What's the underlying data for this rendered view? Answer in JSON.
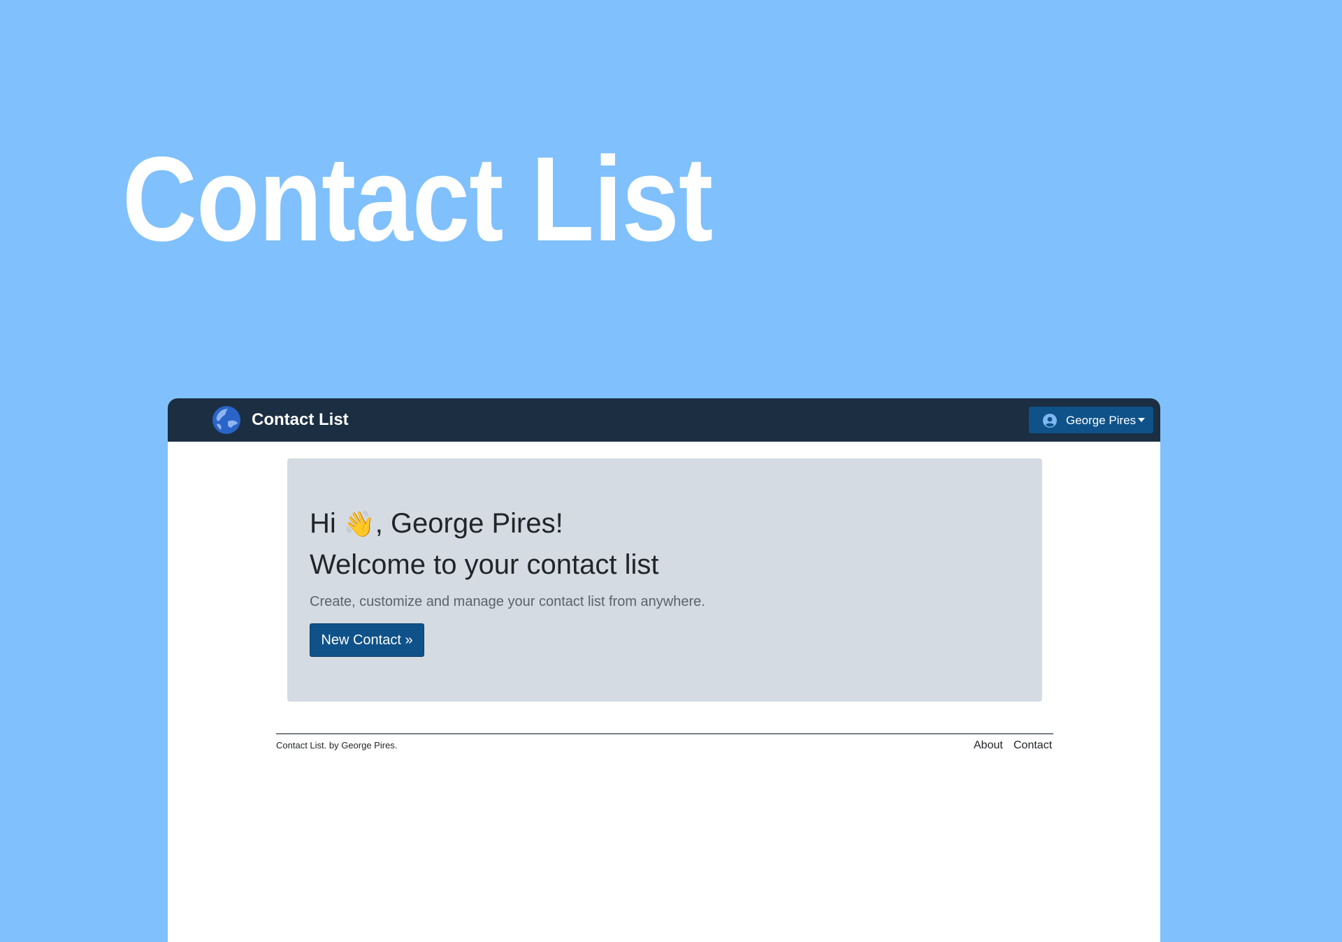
{
  "hero": {
    "title": "Contact List"
  },
  "navbar": {
    "brand_name": "Contact List",
    "brand_logo_icon": "globe-icon",
    "user": {
      "name": "George Pires",
      "icon": "user-circle-icon",
      "caret_icon": "caret-down-icon"
    }
  },
  "jumbotron": {
    "greeting_prefix": "Hi ",
    "wave_emoji": "👋",
    "greeting_suffix": ", George Pires!",
    "welcome": "Welcome to your contact list",
    "lead": "Create, customize and manage your contact list from anywhere.",
    "button_label": "New Contact »"
  },
  "footer": {
    "credit": "Contact List. by George Pires.",
    "links": [
      {
        "label": "About"
      },
      {
        "label": "Contact"
      }
    ]
  },
  "colors": {
    "page_background": "#80c0fc",
    "navbar": "#1c2e42",
    "primary": "#0e5289",
    "jumbotron": "#d4dbe2"
  }
}
